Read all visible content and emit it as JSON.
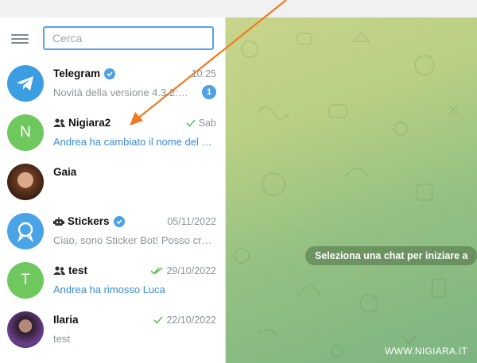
{
  "search": {
    "placeholder": "Cerca"
  },
  "chats": [
    {
      "name": "Telegram",
      "time": "10:25",
      "message": "Novità della versione 4.3.2: - …",
      "badge": "1",
      "verified": true
    },
    {
      "name": "Nigiara2",
      "time": "Sab",
      "message": "Andrea ha cambiato il nome del …",
      "avatar_letter": "N",
      "group": true,
      "read": "single"
    },
    {
      "name": "Gaia",
      "time": "",
      "message": ""
    },
    {
      "name": "Stickers",
      "time": "05/11/2022",
      "message": "Ciao, sono Sticker Bot! Posso cre…",
      "verified": true,
      "bot": true
    },
    {
      "name": "test",
      "time": "29/10/2022",
      "message": "Andrea ha rimosso Luca",
      "avatar_letter": "T",
      "group": true,
      "read": "double"
    },
    {
      "name": "Ilaria",
      "time": "22/10/2022",
      "message": "test",
      "read": "single"
    }
  ],
  "main": {
    "empty_hint": "Seleziona una chat per iniziare a",
    "watermark": "WWW.NIGIARA.IT"
  },
  "colors": {
    "accent": "#4da1e5",
    "group_avatar": "#6ec85d",
    "arrow": "#f07a22"
  }
}
